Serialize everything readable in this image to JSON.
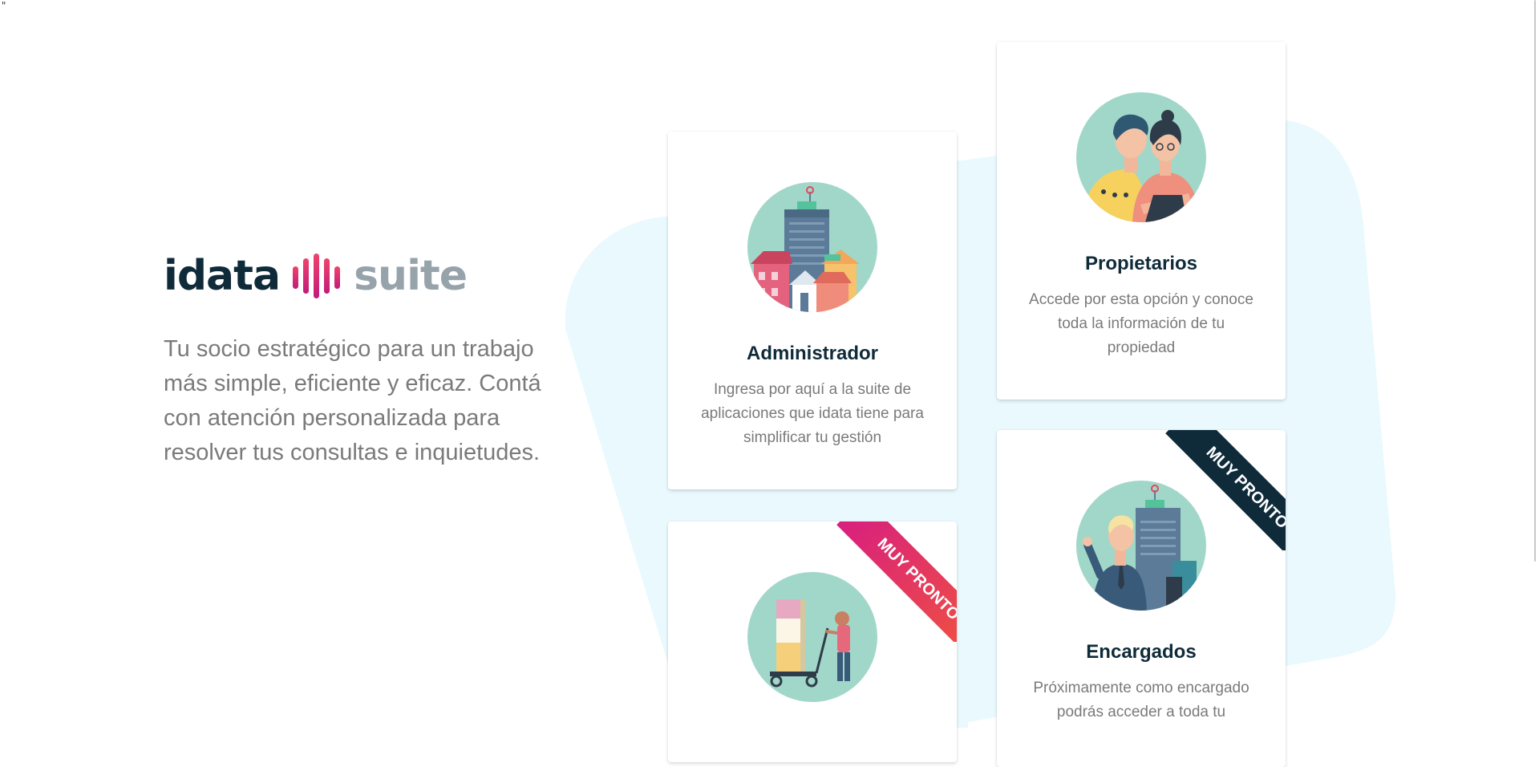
{
  "stray_char": "\"",
  "brand": {
    "word1": "idata",
    "word2": "suite"
  },
  "tagline": "Tu socio estratégico para un trabajo más simple, eficiente y eficaz. Contá con atención personalizada para resolver tus consultas e inquietudes.",
  "cards": {
    "administrador": {
      "title": "Administrador",
      "description": "Ingresa por aquí a la suite de aplicaciones que idata tiene para simplificar tu gestión"
    },
    "propietarios": {
      "title": "Propietarios",
      "description": "Accede por esta opción y conoce toda la información de tu propiedad"
    },
    "proveedores": {
      "ribbon": "MUY PRONTO"
    },
    "encargados": {
      "title": "Encargados",
      "description": "Próximamente como encargado podrás acceder a toda tu",
      "ribbon": "MUY PRONTO"
    }
  },
  "colors": {
    "navy": "#0f2b3a",
    "gray_text": "#7a7a7a",
    "mint": "#a1d7c9",
    "blob": "#e9f9fd",
    "ribbon_pink": "#e3306d",
    "ribbon_navy": "#0f2b3a"
  }
}
